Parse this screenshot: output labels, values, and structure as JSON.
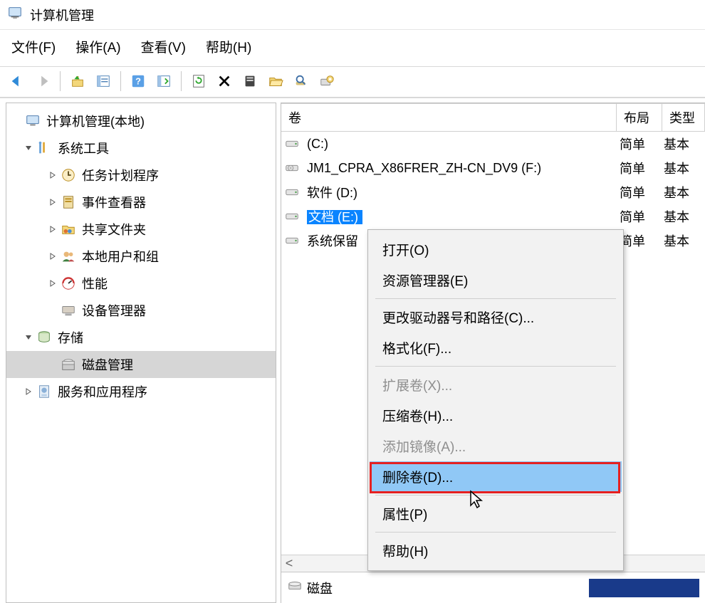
{
  "window": {
    "title": "计算机管理"
  },
  "menu": {
    "file": "文件(F)",
    "action": "操作(A)",
    "view": "查看(V)",
    "help": "帮助(H)"
  },
  "tree": {
    "root": "计算机管理(本地)",
    "system_tools": "系统工具",
    "task_scheduler": "任务计划程序",
    "event_viewer": "事件查看器",
    "shared_folders": "共享文件夹",
    "local_users": "本地用户和组",
    "performance": "性能",
    "device_manager": "设备管理器",
    "storage": "存储",
    "disk_management": "磁盘管理",
    "services_apps": "服务和应用程序"
  },
  "columns": {
    "volume": "卷",
    "layout": "布局",
    "type": "类型"
  },
  "volumes": [
    {
      "name": "(C:)",
      "layout": "简单",
      "type": "基本"
    },
    {
      "name": "JM1_CPRA_X86FRER_ZH-CN_DV9 (F:)",
      "layout": "简单",
      "type": "基本"
    },
    {
      "name": "软件 (D:)",
      "layout": "简单",
      "type": "基本"
    },
    {
      "name": "文档 (E:)",
      "layout": "简单",
      "type": "基本",
      "selected": true
    },
    {
      "name": "系统保留",
      "layout": "简单",
      "type": "基本"
    }
  ],
  "context_menu": {
    "open": "打开(O)",
    "explorer": "资源管理器(E)",
    "change_letter": "更改驱动器号和路径(C)...",
    "format": "格式化(F)...",
    "extend": "扩展卷(X)...",
    "shrink": "压缩卷(H)...",
    "mirror": "添加镜像(A)...",
    "delete": "删除卷(D)...",
    "properties": "属性(P)",
    "help": "帮助(H)"
  },
  "bottom": {
    "disk_label": "磁盘"
  }
}
